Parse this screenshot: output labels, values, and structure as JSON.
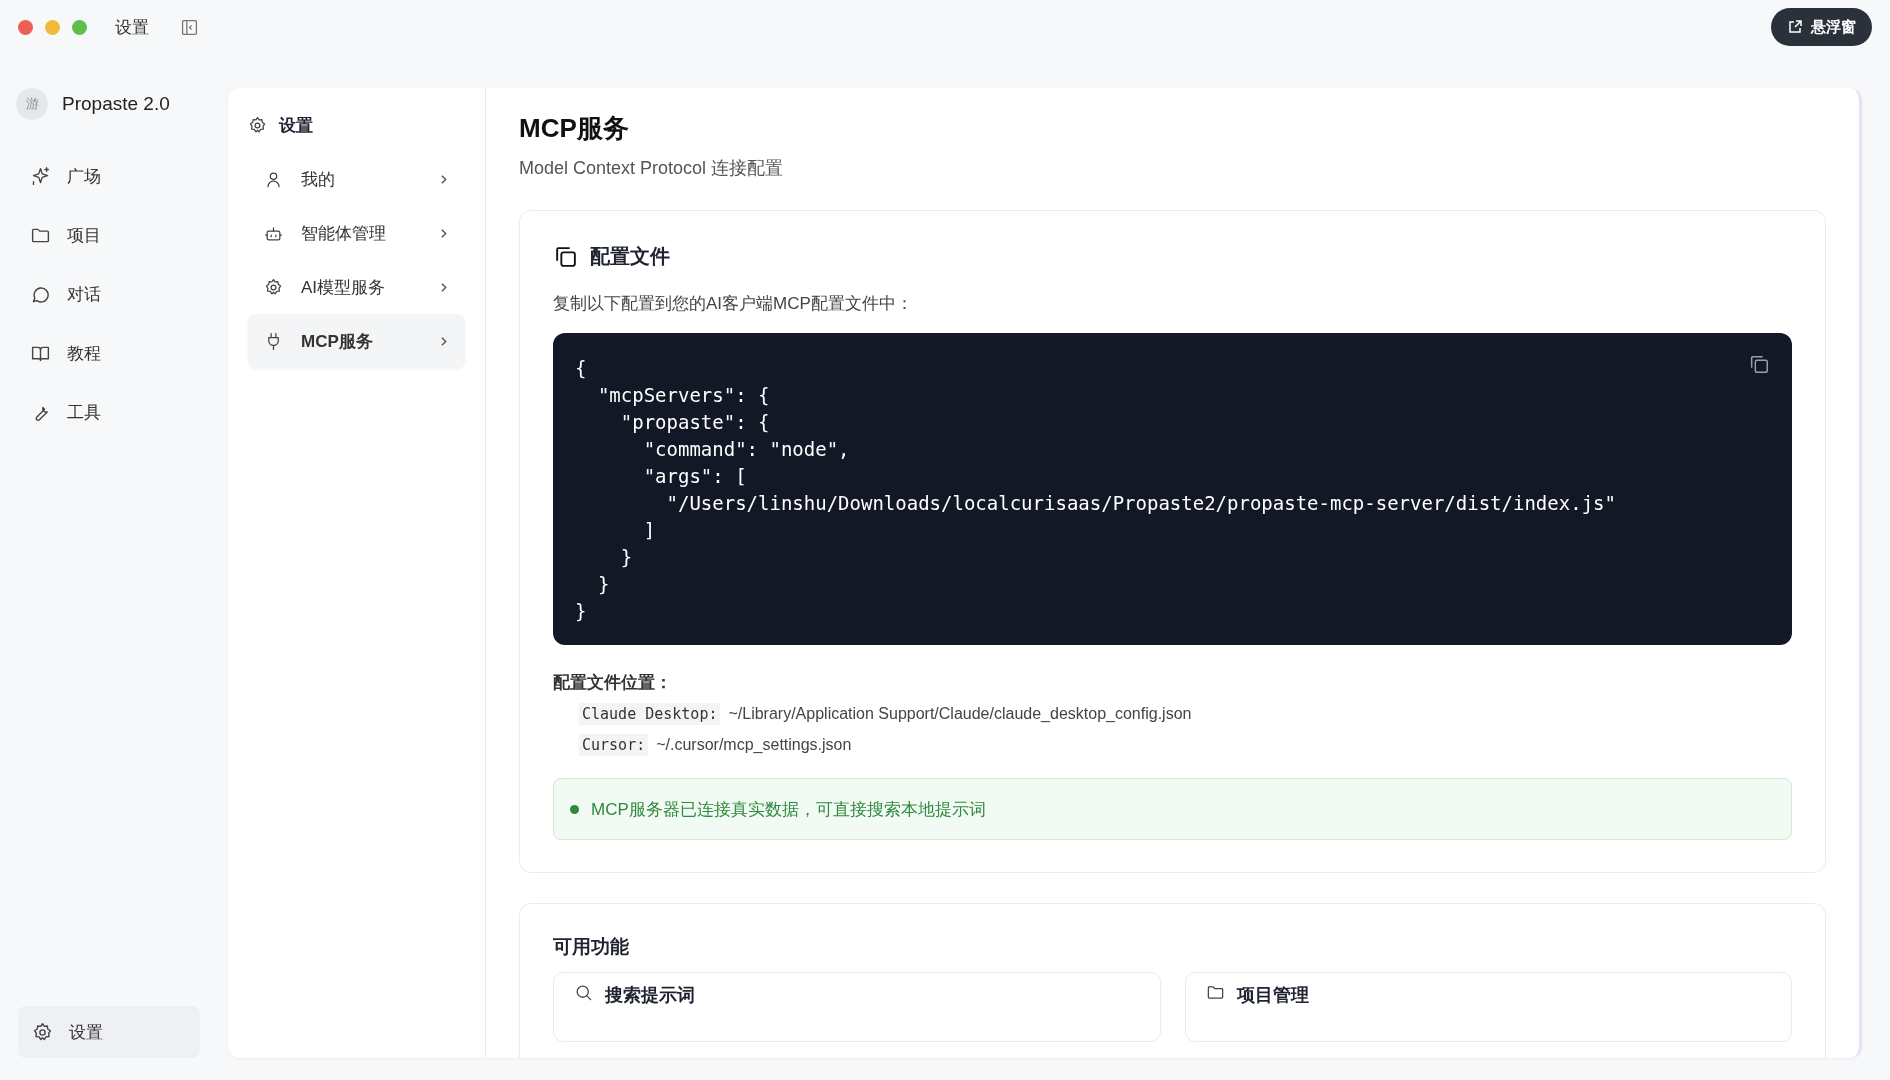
{
  "window": {
    "title": "设置",
    "float_button": "悬浮窗"
  },
  "sidebar": {
    "avatar": "游",
    "app_name": "Propaste 2.0",
    "items": [
      {
        "label": "广场"
      },
      {
        "label": "项目"
      },
      {
        "label": "对话"
      },
      {
        "label": "教程"
      },
      {
        "label": "工具"
      }
    ],
    "footer": {
      "label": "设置"
    }
  },
  "settings_nav": {
    "title": "设置",
    "items": [
      {
        "label": "我的",
        "selected": false
      },
      {
        "label": "智能体管理",
        "selected": false
      },
      {
        "label": "AI模型服务",
        "selected": false
      },
      {
        "label": "MCP服务",
        "selected": true
      }
    ]
  },
  "page": {
    "title": "MCP服务",
    "subtitle": "Model Context Protocol 连接配置",
    "config_card": {
      "title": "配置文件",
      "description": "复制以下配置到您的AI客户端MCP配置文件中：",
      "code_lines": [
        "{",
        "  \"mcpServers\": {",
        "    \"propaste\": {",
        "      \"command\": \"node\",",
        "      \"args\": [",
        "        \"/Users/linshu/Downloads/localcurisaas/Propaste2/propaste-mcp-server/dist/index.js\"",
        "      ]",
        "    }",
        "  }",
        "}"
      ],
      "locations_title": "配置文件位置：",
      "locations": [
        {
          "client": "Claude Desktop:",
          "path": "~/Library/Application Support/Claude/claude_desktop_config.json"
        },
        {
          "client": "Cursor:",
          "path": "~/.cursor/mcp_settings.json"
        }
      ],
      "status": {
        "connected": true,
        "text": "MCP服务器已连接真实数据，可直接搜索本地提示词"
      }
    },
    "features_card": {
      "title": "可用功能",
      "features": [
        {
          "label": "搜索提示词"
        },
        {
          "label": "项目管理"
        }
      ]
    }
  }
}
